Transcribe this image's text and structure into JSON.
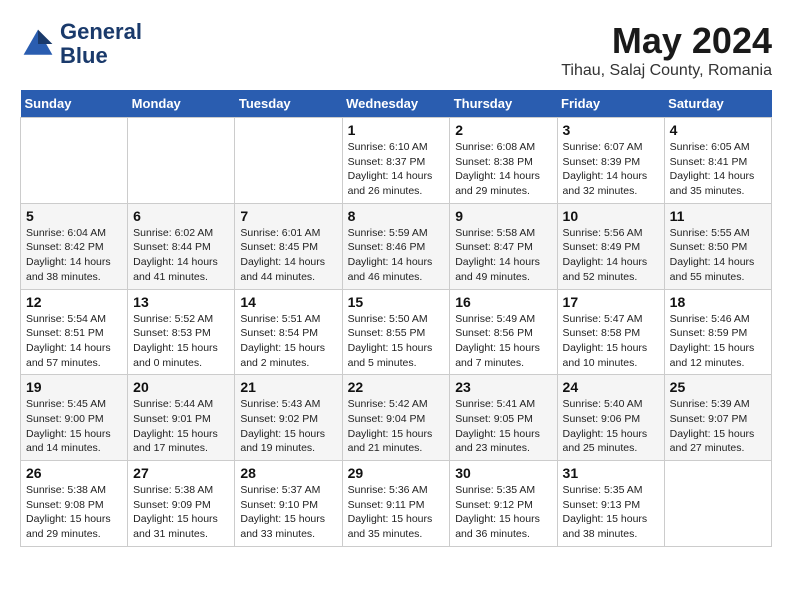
{
  "logo": {
    "name": "GeneralBlue",
    "line1": "General",
    "line2": "Blue"
  },
  "title": "May 2024",
  "subtitle": "Tihau, Salaj County, Romania",
  "days_of_week": [
    "Sunday",
    "Monday",
    "Tuesday",
    "Wednesday",
    "Thursday",
    "Friday",
    "Saturday"
  ],
  "weeks": [
    [
      {
        "day": "",
        "info": ""
      },
      {
        "day": "",
        "info": ""
      },
      {
        "day": "",
        "info": ""
      },
      {
        "day": "1",
        "info": "Sunrise: 6:10 AM\nSunset: 8:37 PM\nDaylight: 14 hours\nand 26 minutes."
      },
      {
        "day": "2",
        "info": "Sunrise: 6:08 AM\nSunset: 8:38 PM\nDaylight: 14 hours\nand 29 minutes."
      },
      {
        "day": "3",
        "info": "Sunrise: 6:07 AM\nSunset: 8:39 PM\nDaylight: 14 hours\nand 32 minutes."
      },
      {
        "day": "4",
        "info": "Sunrise: 6:05 AM\nSunset: 8:41 PM\nDaylight: 14 hours\nand 35 minutes."
      }
    ],
    [
      {
        "day": "5",
        "info": "Sunrise: 6:04 AM\nSunset: 8:42 PM\nDaylight: 14 hours\nand 38 minutes."
      },
      {
        "day": "6",
        "info": "Sunrise: 6:02 AM\nSunset: 8:44 PM\nDaylight: 14 hours\nand 41 minutes."
      },
      {
        "day": "7",
        "info": "Sunrise: 6:01 AM\nSunset: 8:45 PM\nDaylight: 14 hours\nand 44 minutes."
      },
      {
        "day": "8",
        "info": "Sunrise: 5:59 AM\nSunset: 8:46 PM\nDaylight: 14 hours\nand 46 minutes."
      },
      {
        "day": "9",
        "info": "Sunrise: 5:58 AM\nSunset: 8:47 PM\nDaylight: 14 hours\nand 49 minutes."
      },
      {
        "day": "10",
        "info": "Sunrise: 5:56 AM\nSunset: 8:49 PM\nDaylight: 14 hours\nand 52 minutes."
      },
      {
        "day": "11",
        "info": "Sunrise: 5:55 AM\nSunset: 8:50 PM\nDaylight: 14 hours\nand 55 minutes."
      }
    ],
    [
      {
        "day": "12",
        "info": "Sunrise: 5:54 AM\nSunset: 8:51 PM\nDaylight: 14 hours\nand 57 minutes."
      },
      {
        "day": "13",
        "info": "Sunrise: 5:52 AM\nSunset: 8:53 PM\nDaylight: 15 hours\nand 0 minutes."
      },
      {
        "day": "14",
        "info": "Sunrise: 5:51 AM\nSunset: 8:54 PM\nDaylight: 15 hours\nand 2 minutes."
      },
      {
        "day": "15",
        "info": "Sunrise: 5:50 AM\nSunset: 8:55 PM\nDaylight: 15 hours\nand 5 minutes."
      },
      {
        "day": "16",
        "info": "Sunrise: 5:49 AM\nSunset: 8:56 PM\nDaylight: 15 hours\nand 7 minutes."
      },
      {
        "day": "17",
        "info": "Sunrise: 5:47 AM\nSunset: 8:58 PM\nDaylight: 15 hours\nand 10 minutes."
      },
      {
        "day": "18",
        "info": "Sunrise: 5:46 AM\nSunset: 8:59 PM\nDaylight: 15 hours\nand 12 minutes."
      }
    ],
    [
      {
        "day": "19",
        "info": "Sunrise: 5:45 AM\nSunset: 9:00 PM\nDaylight: 15 hours\nand 14 minutes."
      },
      {
        "day": "20",
        "info": "Sunrise: 5:44 AM\nSunset: 9:01 PM\nDaylight: 15 hours\nand 17 minutes."
      },
      {
        "day": "21",
        "info": "Sunrise: 5:43 AM\nSunset: 9:02 PM\nDaylight: 15 hours\nand 19 minutes."
      },
      {
        "day": "22",
        "info": "Sunrise: 5:42 AM\nSunset: 9:04 PM\nDaylight: 15 hours\nand 21 minutes."
      },
      {
        "day": "23",
        "info": "Sunrise: 5:41 AM\nSunset: 9:05 PM\nDaylight: 15 hours\nand 23 minutes."
      },
      {
        "day": "24",
        "info": "Sunrise: 5:40 AM\nSunset: 9:06 PM\nDaylight: 15 hours\nand 25 minutes."
      },
      {
        "day": "25",
        "info": "Sunrise: 5:39 AM\nSunset: 9:07 PM\nDaylight: 15 hours\nand 27 minutes."
      }
    ],
    [
      {
        "day": "26",
        "info": "Sunrise: 5:38 AM\nSunset: 9:08 PM\nDaylight: 15 hours\nand 29 minutes."
      },
      {
        "day": "27",
        "info": "Sunrise: 5:38 AM\nSunset: 9:09 PM\nDaylight: 15 hours\nand 31 minutes."
      },
      {
        "day": "28",
        "info": "Sunrise: 5:37 AM\nSunset: 9:10 PM\nDaylight: 15 hours\nand 33 minutes."
      },
      {
        "day": "29",
        "info": "Sunrise: 5:36 AM\nSunset: 9:11 PM\nDaylight: 15 hours\nand 35 minutes."
      },
      {
        "day": "30",
        "info": "Sunrise: 5:35 AM\nSunset: 9:12 PM\nDaylight: 15 hours\nand 36 minutes."
      },
      {
        "day": "31",
        "info": "Sunrise: 5:35 AM\nSunset: 9:13 PM\nDaylight: 15 hours\nand 38 minutes."
      },
      {
        "day": "",
        "info": ""
      }
    ]
  ]
}
